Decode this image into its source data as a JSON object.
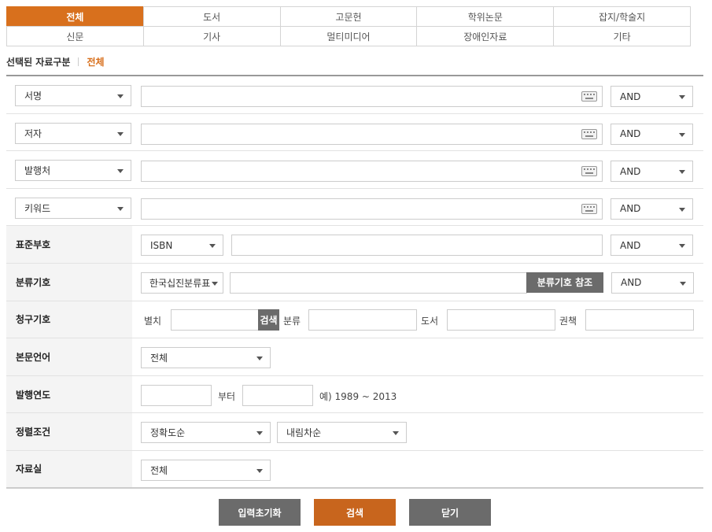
{
  "tabs": {
    "row1": [
      "전체",
      "도서",
      "고문헌",
      "학위논문",
      "잡지/학술지"
    ],
    "row2": [
      "신문",
      "기사",
      "멀티미디어",
      "장애인자료",
      "기타"
    ]
  },
  "selected": {
    "label": "선택된 자료구분",
    "value": "전체"
  },
  "fields": {
    "title_select": "서명",
    "author_select": "저자",
    "publisher_select": "발행처",
    "keyword_select": "키워드",
    "op": "AND"
  },
  "labels": {
    "standard_no": "표준부호",
    "class_no": "분류기호",
    "call_no": "청구기호",
    "language": "본문언어",
    "pub_year": "발행연도",
    "sort": "정렬조건",
    "room": "자료실"
  },
  "standard_no": {
    "select": "ISBN",
    "op": "AND"
  },
  "class_no": {
    "select": "한국십진분류표",
    "ref_button": "분류기호 참조",
    "op": "AND"
  },
  "call_no": {
    "separate": "별치",
    "search": "검색",
    "class": "분류",
    "book": "도서",
    "volume": "권책"
  },
  "language": {
    "select": "전체"
  },
  "pub_year": {
    "from_suffix": "부터",
    "example": "예) 1989 ~ 2013"
  },
  "sort": {
    "order_by": "정확도순",
    "direction": "내림차순"
  },
  "room": {
    "select": "전체"
  },
  "buttons": {
    "reset": "입력초기화",
    "search": "검색",
    "close": "닫기"
  }
}
